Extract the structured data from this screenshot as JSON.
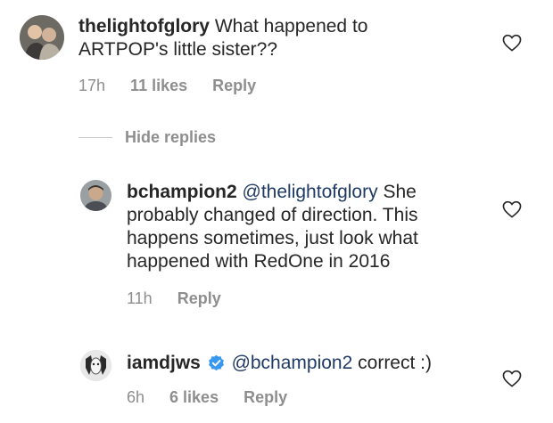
{
  "comments": [
    {
      "username": "thelightofglory",
      "text_line1": "What happened to",
      "text_line2": "ARTPOP's little sister??",
      "time": "17h",
      "likes": "11 likes",
      "reply": "Reply",
      "avatar_icon": "avatar-photo"
    }
  ],
  "hide_replies": "Hide replies",
  "replies": [
    {
      "username": "bchampion2",
      "mention": "@thelightofglory",
      "text_line1_rest": "She",
      "text_line2": "probably changed of direction. This",
      "text_line3": "happens sometimes, just look what",
      "text_line4": "happened with RedOne in 2016",
      "time": "11h",
      "reply": "Reply"
    },
    {
      "username": "iamdjws",
      "verified": true,
      "mention": "@bchampion2",
      "text_rest": "correct :)",
      "time": "6h",
      "likes": "6 likes",
      "reply": "Reply"
    }
  ],
  "colors": {
    "text": "#262626",
    "muted": "#8e8e8e",
    "mention": "#1f3a66",
    "verified": "#3897f0"
  }
}
